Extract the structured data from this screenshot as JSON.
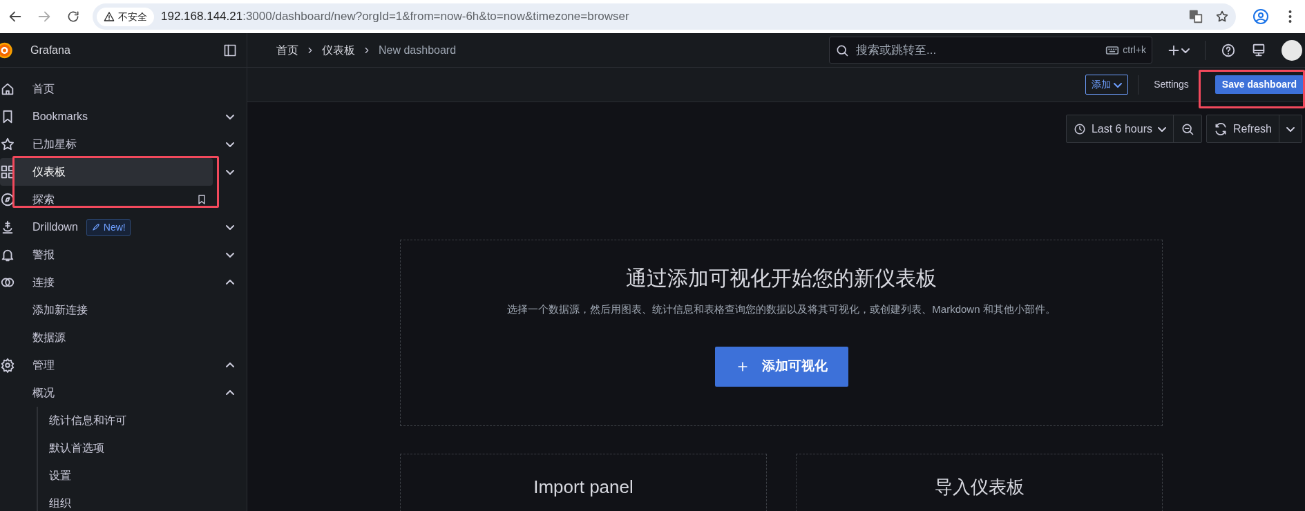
{
  "browser": {
    "security": "不安全",
    "url_host": "192.168.144.21",
    "url_rest": ":3000/dashboard/new?orgId=1&from=now-6h&to=now&timezone=browser"
  },
  "sidebar": {
    "brand": "Grafana",
    "items": [
      {
        "label": "首页",
        "selected": false
      },
      {
        "label": "Bookmarks",
        "selected": false,
        "expanded": false
      },
      {
        "label": "已加星标",
        "selected": false,
        "expanded": false
      },
      {
        "label": "仪表板",
        "selected": true,
        "expanded": false
      },
      {
        "label": "探索",
        "selected": false,
        "pin": true
      },
      {
        "label": "Drilldown",
        "selected": false,
        "expanded": false,
        "badge": "New!"
      },
      {
        "label": "警报",
        "selected": false,
        "expanded": false
      },
      {
        "label": "连接",
        "selected": false,
        "expanded": true,
        "children": [
          {
            "label": "添加新连接",
            "selected": false
          },
          {
            "label": "数据源",
            "selected": false
          }
        ]
      },
      {
        "label": "管理",
        "selected": false,
        "expanded": true,
        "children": [
          {
            "label": "概况",
            "selected": false,
            "expanded": true,
            "children": [
              {
                "label": "统计信息和许可",
                "selected": false
              },
              {
                "label": "默认首选项",
                "selected": false
              },
              {
                "label": "设置",
                "selected": false
              },
              {
                "label": "组织",
                "selected": false
              }
            ]
          }
        ]
      }
    ]
  },
  "topbar": {
    "breadcrumbs": [
      {
        "label": "首页",
        "current": false
      },
      {
        "label": "仪表板",
        "current": false
      },
      {
        "label": "New dashboard",
        "current": true
      }
    ],
    "search": {
      "placeholder": "搜索或跳转至...",
      "shortcut": "ctrl+k"
    }
  },
  "toolbar": {
    "add": "添加",
    "settings": "Settings",
    "save": "Save dashboard"
  },
  "time": {
    "range": "Last 6 hours",
    "refresh": "Refresh"
  },
  "empty_state": {
    "title": "通过添加可视化开始您的新仪表板",
    "description": "选择一个数据源，然后用图表、统计信息和表格查询您的数据以及将其可视化，或创建列表、Markdown 和其他小部件。",
    "button": "添加可视化"
  },
  "cards": [
    {
      "title": "Import panel"
    },
    {
      "title": "导入仪表板"
    }
  ]
}
